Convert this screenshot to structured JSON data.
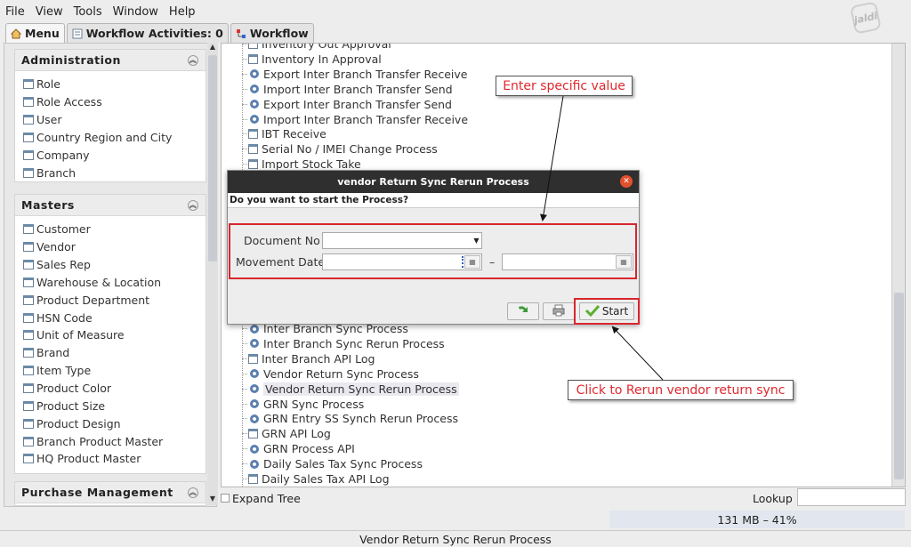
{
  "menubar": {
    "file": "File",
    "view": "View",
    "tools": "Tools",
    "window": "Window",
    "help": "Help",
    "logo": "jaldi"
  },
  "tabs": [
    {
      "label": "Menu"
    },
    {
      "label": "Workflow Activities: 0"
    },
    {
      "label": "Workflow"
    }
  ],
  "sidebar": {
    "administration": {
      "title": "Administration",
      "items": [
        "Role",
        "Role Access",
        "User",
        "Country Region and City",
        "Company",
        "Branch"
      ]
    },
    "masters": {
      "title": "Masters",
      "items": [
        "Customer",
        "Vendor",
        "Sales Rep",
        "Warehouse & Location",
        "Product Department",
        "HSN Code",
        "Unit of Measure",
        "Brand",
        "Item Type",
        "Product Color",
        "Product Size",
        "Product Design",
        "Branch Product Master",
        "HQ Product Master"
      ]
    },
    "purchase": {
      "title": "Purchase Management"
    }
  },
  "tree": {
    "top_rows": [
      {
        "label": "Inventory Out Approval",
        "icon": "doc-icon"
      },
      {
        "label": "Inventory In Approval",
        "icon": "doc-icon"
      },
      {
        "label": "Export Inter Branch Transfer Receive",
        "icon": "gear-icon"
      },
      {
        "label": "Import Inter Branch Transfer Send",
        "icon": "gear-icon"
      },
      {
        "label": "Export Inter Branch Transfer Send",
        "icon": "gear-icon"
      },
      {
        "label": "Import Inter Branch Transfer Receive",
        "icon": "gear-icon"
      },
      {
        "label": "IBT Receive",
        "icon": "doc-icon"
      },
      {
        "label": "Serial No / IMEI Change Process",
        "icon": "doc-icon"
      },
      {
        "label": "Import Stock Take",
        "icon": "doc-icon"
      }
    ],
    "bottom_rows": [
      {
        "label": "Inter Branch Sync Process",
        "icon": "gear-icon"
      },
      {
        "label": "Inter Branch Sync Rerun Process",
        "icon": "gear-icon"
      },
      {
        "label": "Inter Branch API Log",
        "icon": "doc-icon"
      },
      {
        "label": "Vendor Return Sync Process",
        "icon": "gear-icon"
      },
      {
        "label": "Vendor Return Sync Rerun Process",
        "icon": "gear-icon",
        "selected": true
      },
      {
        "label": "GRN Sync Process",
        "icon": "gear-icon"
      },
      {
        "label": "GRN Entry SS Synch Rerun Process",
        "icon": "gear-icon"
      },
      {
        "label": "GRN API Log",
        "icon": "doc-icon"
      },
      {
        "label": "GRN Process API",
        "icon": "gear-icon"
      },
      {
        "label": "Daily Sales Tax Sync Process",
        "icon": "gear-icon"
      },
      {
        "label": "Daily Sales Tax API Log",
        "icon": "doc-icon"
      }
    ]
  },
  "bottom": {
    "expand_tree": "Expand Tree",
    "lookup": "Lookup",
    "lookup_value": ""
  },
  "memory": "131 MB – 41%",
  "statusbar": "Vendor Return Sync Rerun Process",
  "dialog": {
    "title": "vendor Return Sync Rerun Process",
    "question": "Do you want to start the Process?",
    "document_no_label": "Document No",
    "document_no_value": "",
    "movement_date_label": "Movement Date",
    "movement_date_from": "",
    "range_separator": "–",
    "movement_date_to": "",
    "start_label": "Start"
  },
  "annotations": {
    "enter_value": "Enter specific value",
    "click_rerun": "Click to Rerun vendor return sync",
    "color": "#e0282e"
  }
}
